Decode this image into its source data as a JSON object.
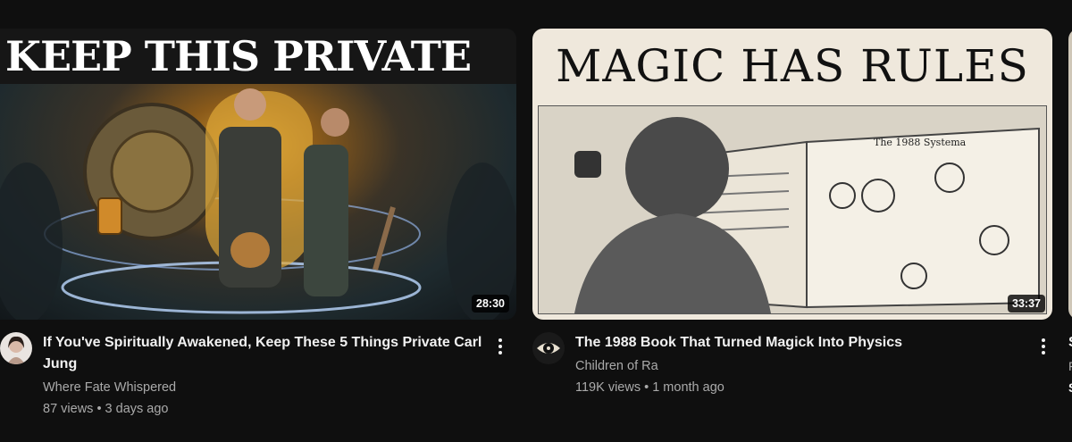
{
  "videos": [
    {
      "thumbnail_text": "KEEP THIS PRIVATE",
      "duration": "28:30",
      "title": "If You've Spiritually Awakened, Keep These 5 Things Private Carl Jung",
      "channel": "Where Fate Whispered",
      "stats": "87 views • 3 days ago",
      "menu_icon": "more-vert-icon"
    },
    {
      "thumbnail_text": "MAGIC HAS RULES",
      "thumbnail_book_heading": "The 1988 Systema",
      "duration": "33:37",
      "title": "The 1988 Book That Turned Magick Into Physics",
      "channel": "Children of Ra",
      "stats": "119K views • 1 month ago",
      "menu_icon": "more-vert-icon"
    },
    {
      "title_partial": "S",
      "channel_partial": "F",
      "stats_partial": "S"
    }
  ],
  "colors": {
    "background": "#0f0f0f",
    "title": "#f1f1f1",
    "secondary_text": "#aaaaaa",
    "duration_badge": "#000000cc"
  }
}
